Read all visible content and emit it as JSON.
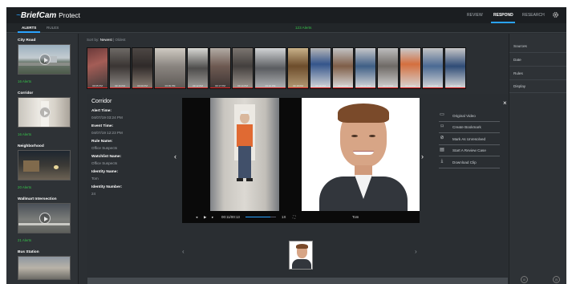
{
  "header": {
    "brand_name": "BriefCam",
    "brand_product": "Protect",
    "nav": [
      {
        "label": "REVIEW"
      },
      {
        "label": "RESPOND"
      },
      {
        "label": "RESEARCH"
      }
    ],
    "active_nav": "RESPOND",
    "accent_color": "#2aa3ff"
  },
  "subbar": {
    "tabs": [
      {
        "label": "ALERTS"
      },
      {
        "label": "RULES"
      }
    ],
    "alert_total": "123 Alerts"
  },
  "sidebar": {
    "locations": [
      {
        "name": "City Road",
        "alerts": "16 Alerts"
      },
      {
        "name": "Corridor",
        "alerts": "16 Alerts"
      },
      {
        "name": "Neighborhood",
        "alerts": "20 Alerts"
      },
      {
        "name": "Wallmart Intersection",
        "alerts": "21 Alerts"
      },
      {
        "name": "Bus Station",
        "alerts": ""
      }
    ],
    "alert_color": "#36c24a"
  },
  "sort": {
    "label": "Sort by:",
    "newest": "Newest",
    "separator": "|",
    "oldest": "Oldest"
  },
  "strip": {
    "timestamps": [
      "03:05 PM",
      "03:16 PM",
      "03:09 PM",
      "03:09 PM",
      "03:12 PM",
      "03:17 PM",
      "03:14 PM",
      "03:16 PM",
      "03:18 PM",
      "03:19 PM",
      "03:20 PM",
      "03:21 PM",
      "03:22 PM",
      "03:23 PM",
      "03:24 PM",
      "03:27 PM"
    ]
  },
  "right_panel": {
    "items": [
      {
        "label": "Sources"
      },
      {
        "label": "Date"
      },
      {
        "label": "Rules"
      },
      {
        "label": "Display"
      }
    ]
  },
  "detail": {
    "title": "Corridor",
    "fields": [
      {
        "label": "Alert Time:",
        "value": "04/07/19 03:24 PM"
      },
      {
        "label": "Event Time:",
        "value": "04/07/19 12:23 PM"
      },
      {
        "label": "Rule Name:",
        "value": "Office Suspects"
      },
      {
        "label": "Watchlist Name:",
        "value": "Office Suspects"
      },
      {
        "label": "Identity Name:",
        "value": "Tom"
      },
      {
        "label": "Identity Number:",
        "value": "24"
      }
    ],
    "player": {
      "time": "00:11/00:13",
      "speed": "1X",
      "identity_caption": "Tom",
      "progress": 0.82
    },
    "actions": [
      {
        "label": "Original Video",
        "icon": "video-camera-icon"
      },
      {
        "label": "Create Bookmark",
        "icon": "bookmark-icon"
      },
      {
        "label": "Mark As Unresolved",
        "icon": "eye-slash-icon"
      },
      {
        "label": "Start A Review Case",
        "icon": "case-icon"
      },
      {
        "label": "Download Clip",
        "icon": "download-icon"
      }
    ]
  }
}
